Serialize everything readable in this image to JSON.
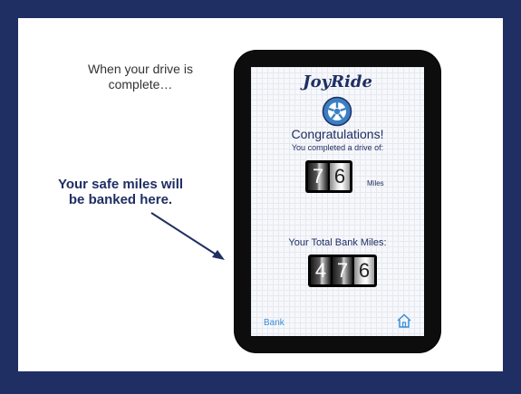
{
  "slide": {
    "caption_top": "When your drive is complete…",
    "callout": "Your safe miles will be banked here."
  },
  "app": {
    "logo": "JoyRide",
    "congrats": "Congratulations!",
    "drive_text": "You completed a drive of:",
    "drive_digits": [
      "7",
      "6"
    ],
    "miles_label": "Miles",
    "total_title": "Your Total Bank Miles:",
    "bank_digits": [
      "4",
      "7",
      "6"
    ],
    "bank_link": "Bank"
  },
  "colors": {
    "frame": "#1f2f63",
    "brand_blue": "#1f2f63",
    "link_blue": "#3a8fd8"
  },
  "icons": {
    "wheel": "wheel-icon",
    "home": "home-icon"
  }
}
